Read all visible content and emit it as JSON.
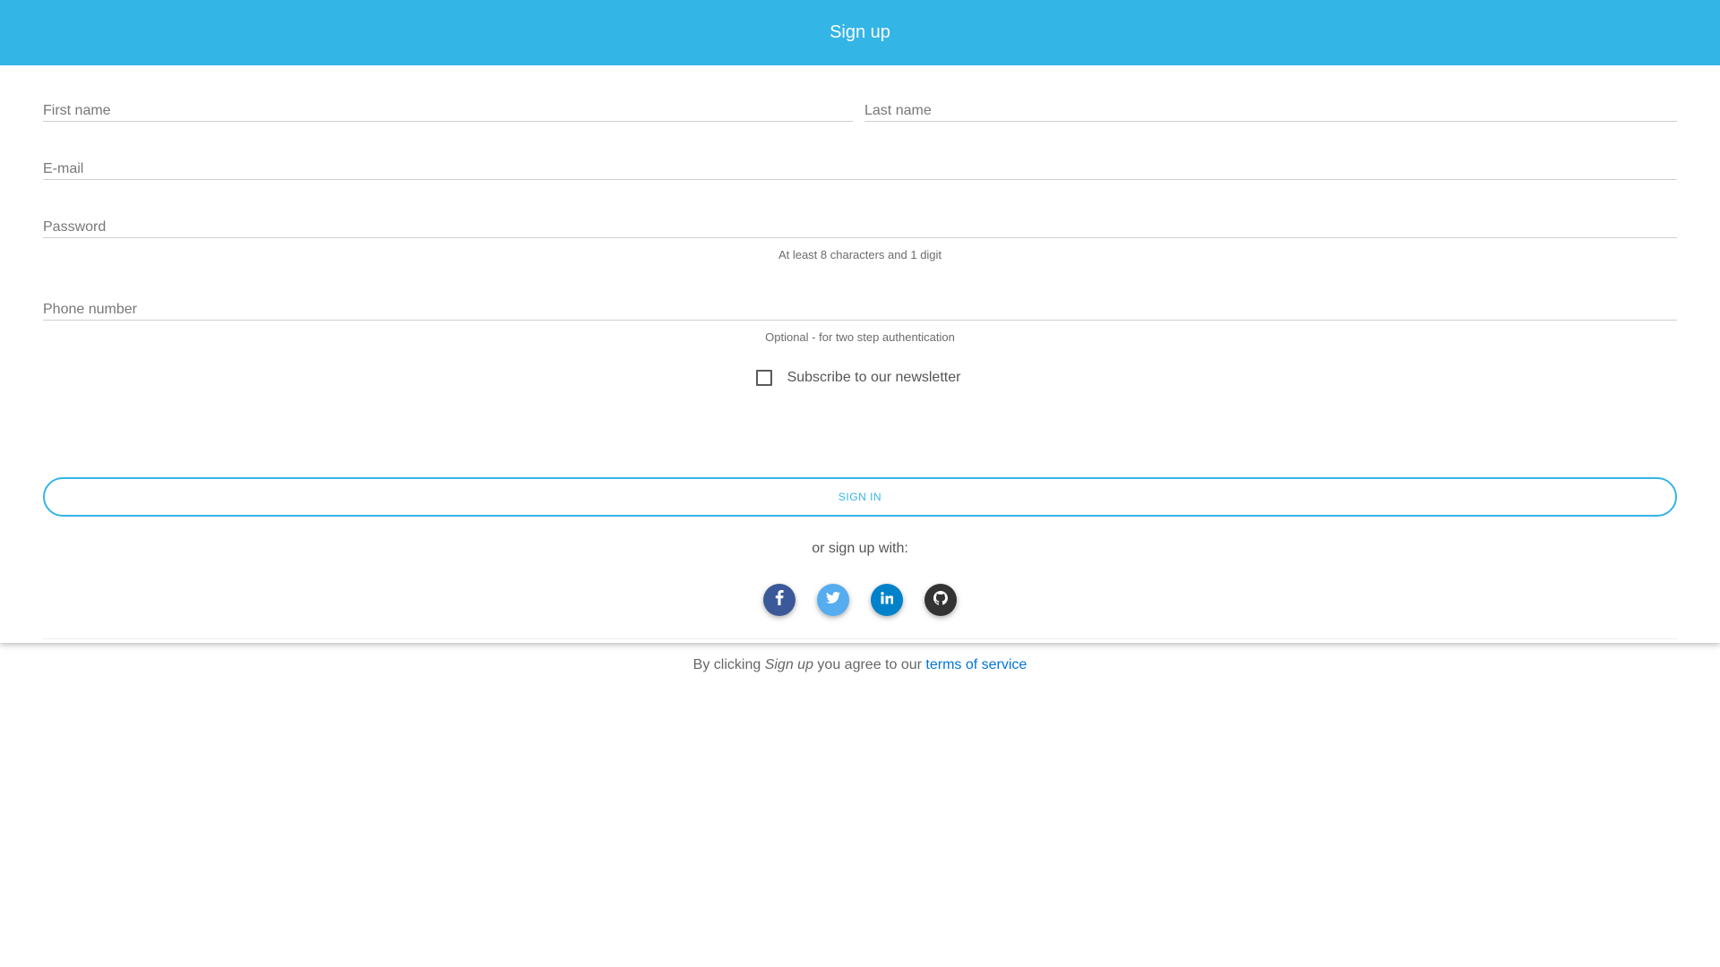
{
  "header": {
    "title": "Sign up"
  },
  "form": {
    "first_name": {
      "value": "",
      "placeholder": "First name"
    },
    "last_name": {
      "value": "",
      "placeholder": "Last name"
    },
    "email": {
      "value": "",
      "placeholder": "E-mail"
    },
    "password": {
      "value": "",
      "placeholder": "Password",
      "hint": "At least 8 characters and 1 digit"
    },
    "phone": {
      "value": "",
      "placeholder": "Phone number",
      "hint": "Optional - for two step authentication"
    },
    "newsletter": {
      "label": "Subscribe to our newsletter",
      "checked": false
    },
    "submit_label": "Sign in"
  },
  "social": {
    "prompt": "or sign up with:",
    "providers": [
      {
        "name": "facebook",
        "glyph": "f",
        "color": "#3b5998"
      },
      {
        "name": "twitter",
        "glyph": "t",
        "color": "#55acee"
      },
      {
        "name": "linkedin",
        "glyph": "in",
        "color": "#0082ca"
      },
      {
        "name": "github",
        "glyph": "gh",
        "color": "#333333"
      }
    ]
  },
  "terms": {
    "prefix": "By clicking",
    "emphasis": "Sign up",
    "middle": "you agree to our",
    "link_text": "terms of service"
  },
  "colors": {
    "header_bg": "#33b5e5",
    "accent": "#33b5e5",
    "link": "#0275d8"
  }
}
